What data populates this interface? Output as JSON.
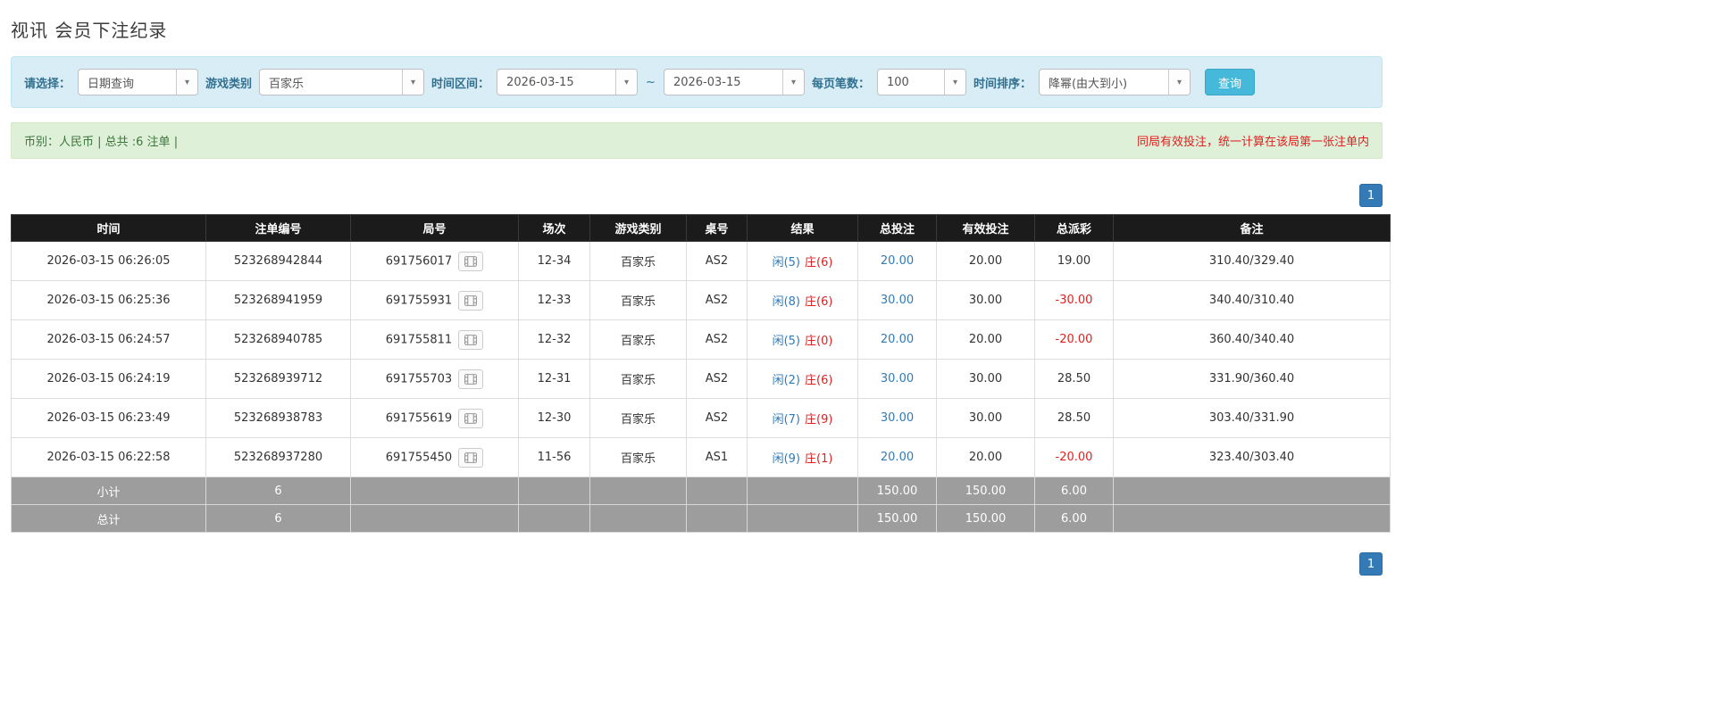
{
  "page": {
    "title": "视讯 会员下注纪录"
  },
  "colors": {
    "accent_blue": "#337ab7",
    "search_button_blue": "#46b8da",
    "danger_red": "#dd2222",
    "table_header_bg": "#1b1b1b",
    "summary_row_bg": "#9d9d9d",
    "filter_panel_bg": "#d9edf7",
    "info_bar_bg": "#dff0d8"
  },
  "filter": {
    "select_label": "请选择：",
    "select_value": "日期查询",
    "game_type_label": "游戏类别",
    "game_type_value": "百家乐",
    "time_range_label": "时间区间：",
    "date_from": "2026-03-15",
    "range_separator": "~",
    "date_to": "2026-03-15",
    "page_size_label": "每页笔数：",
    "page_size_value": "100",
    "sort_label": "时间排序：",
    "sort_value": "降幂(由大到小)",
    "search_button": "查询",
    "dropdown_arrow": "▾"
  },
  "summary": {
    "currency_info": "币别：人民币 | 总共 :6 注单 |",
    "notice": "同局有效投注，统一计算在该局第一张注单内"
  },
  "pagination": {
    "page_label": "1"
  },
  "table": {
    "headers": [
      "时间",
      "注单编号",
      "局号",
      "场次",
      "游戏类别",
      "桌号",
      "结果",
      "总投注",
      "有效投注",
      "总派彩",
      "备注"
    ],
    "rows": [
      {
        "time": "2026-03-15 06:26:05",
        "bet_id": "523268942844",
        "round_id": "691756017",
        "session": "12-34",
        "game_type": "百家乐",
        "table_no": "AS2",
        "result_player": "闲(5)",
        "result_banker": "庄(6)",
        "total_bet": "20.00",
        "valid_bet": "20.00",
        "payout": "19.00",
        "note": "310.40/329.40"
      },
      {
        "time": "2026-03-15 06:25:36",
        "bet_id": "523268941959",
        "round_id": "691755931",
        "session": "12-33",
        "game_type": "百家乐",
        "table_no": "AS2",
        "result_player": "闲(8)",
        "result_banker": "庄(6)",
        "total_bet": "30.00",
        "valid_bet": "30.00",
        "payout": "-30.00",
        "note": "340.40/310.40"
      },
      {
        "time": "2026-03-15 06:24:57",
        "bet_id": "523268940785",
        "round_id": "691755811",
        "session": "12-32",
        "game_type": "百家乐",
        "table_no": "AS2",
        "result_player": "闲(5)",
        "result_banker": "庄(0)",
        "total_bet": "20.00",
        "valid_bet": "20.00",
        "payout": "-20.00",
        "note": "360.40/340.40"
      },
      {
        "time": "2026-03-15 06:24:19",
        "bet_id": "523268939712",
        "round_id": "691755703",
        "session": "12-31",
        "game_type": "百家乐",
        "table_no": "AS2",
        "result_player": "闲(2)",
        "result_banker": "庄(6)",
        "total_bet": "30.00",
        "valid_bet": "30.00",
        "payout": "28.50",
        "note": "331.90/360.40"
      },
      {
        "time": "2026-03-15 06:23:49",
        "bet_id": "523268938783",
        "round_id": "691755619",
        "session": "12-30",
        "game_type": "百家乐",
        "table_no": "AS2",
        "result_player": "闲(7)",
        "result_banker": "庄(9)",
        "total_bet": "30.00",
        "valid_bet": "30.00",
        "payout": "28.50",
        "note": "303.40/331.90"
      },
      {
        "time": "2026-03-15 06:22:58",
        "bet_id": "523268937280",
        "round_id": "691755450",
        "session": "11-56",
        "game_type": "百家乐",
        "table_no": "AS1",
        "result_player": "闲(9)",
        "result_banker": "庄(1)",
        "total_bet": "20.00",
        "valid_bet": "20.00",
        "payout": "-20.00",
        "note": "323.40/303.40"
      }
    ],
    "footer_rows": [
      {
        "label": "小计",
        "count": "6",
        "total_bet": "150.00",
        "valid_bet": "150.00",
        "payout": "6.00"
      },
      {
        "label": "总计",
        "count": "6",
        "total_bet": "150.00",
        "valid_bet": "150.00",
        "payout": "6.00"
      }
    ]
  }
}
